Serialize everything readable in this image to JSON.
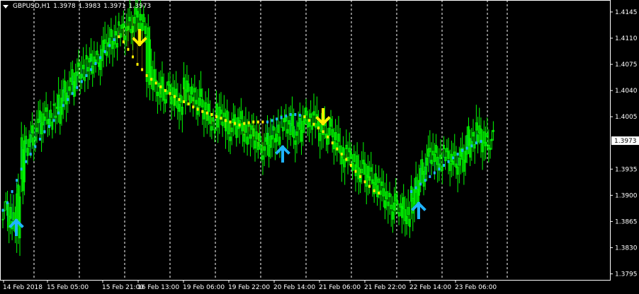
{
  "symbol_header": {
    "symbol": "GBPUSD,H1",
    "open": "1.3978",
    "high": "1.3983",
    "low": "1.3971",
    "close": "1.3973"
  },
  "colors": {
    "background": "#000000",
    "bull_candle": "#00ff00",
    "bear_candle": "#00ff00",
    "grid": "#ffffff",
    "up_signal": "#1fb3ff",
    "down_signal": "#ffee00",
    "price_label_bg": "#ffffff",
    "price_label_fg": "#000000"
  },
  "price_labels": [
    "1.4145",
    "1.4110",
    "1.4075",
    "1.4040",
    "1.4005",
    "1.3973",
    "1.3935",
    "1.3900",
    "1.3865",
    "1.3830",
    "1.3795"
  ],
  "current_price": "1.3973",
  "time_labels": [
    "14 Feb 2018",
    "15 Feb 05:00",
    "15 Feb 21:00",
    "16 Feb 13:00",
    "19 Feb 06:00",
    "19 Feb 22:00",
    "20 Feb 14:00",
    "21 Feb 06:00",
    "21 Feb 22:00",
    "22 Feb 14:00",
    "23 Feb 06:00"
  ],
  "chart_data": {
    "type": "candlestick",
    "title": "GBPUSD,H1",
    "ylim": [
      1.3787,
      1.4161
    ],
    "series": [
      {
        "name": "price",
        "values": [
          1.388,
          1.3865,
          1.3855,
          1.391,
          1.3965,
          1.3975,
          1.3985,
          1.399,
          1.4005,
          1.4,
          1.401,
          1.4008,
          1.403,
          1.4045,
          1.404,
          1.406,
          1.4065,
          1.407,
          1.4075,
          1.4085,
          1.408,
          1.4095,
          1.41,
          1.411,
          1.4115,
          1.412,
          1.4125,
          1.413,
          1.4138,
          1.413,
          1.412,
          1.406,
          1.4045,
          1.405,
          1.4035,
          1.404,
          1.403,
          1.402,
          1.403,
          1.4045,
          1.4035,
          1.403,
          1.402,
          1.401,
          1.4,
          1.3995,
          1.401,
          1.4005,
          1.399,
          1.3985,
          1.4,
          1.399,
          1.398,
          1.3985,
          1.3975,
          1.3965,
          1.396,
          1.3975,
          1.398,
          1.399,
          1.3995,
          1.4,
          1.3985,
          1.398,
          1.3995,
          1.4005,
          1.4,
          1.3995,
          1.3985,
          1.399,
          1.398,
          1.397,
          1.396,
          1.395,
          1.3955,
          1.3945,
          1.393,
          1.3935,
          1.392,
          1.3925,
          1.391,
          1.3905,
          1.3895,
          1.389,
          1.388,
          1.3885,
          1.387,
          1.388,
          1.39,
          1.392,
          1.394,
          1.395,
          1.3955,
          1.3945,
          1.395,
          1.3955,
          1.3945,
          1.395,
          1.394,
          1.3955,
          1.398,
          1.3975,
          1.3985,
          1.397,
          1.3975,
          1.3973
        ]
      },
      {
        "name": "blue_line",
        "values": [
          1.388,
          1.389,
          1.3905,
          1.392,
          1.3935,
          1.3945,
          1.3955,
          1.3965,
          1.3975,
          1.3985,
          1.3992,
          1.4,
          1.401,
          1.402,
          1.4028,
          1.4036,
          1.4044,
          1.4052,
          1.406,
          1.4068,
          1.4076,
          1.4084,
          1.4092,
          1.41,
          1.4108,
          1.4112,
          null,
          null,
          null,
          null,
          null,
          null,
          null,
          null,
          null,
          null,
          null,
          null,
          null,
          null,
          null,
          null,
          null,
          null,
          null,
          null,
          null,
          null,
          null,
          null,
          null,
          null,
          null,
          null,
          null,
          null,
          null,
          1.3998,
          1.4,
          1.4002,
          1.4004,
          1.4006,
          1.4008,
          1.4008,
          1.4007,
          null,
          null,
          null,
          null,
          null,
          null,
          null,
          null,
          null,
          null,
          null,
          null,
          null,
          null,
          null,
          null,
          null,
          null,
          null,
          null,
          null,
          null,
          null,
          1.3905,
          1.391,
          1.3915,
          1.392,
          1.3925,
          1.393,
          1.3935,
          1.394,
          1.3945,
          1.395,
          1.3955,
          1.396,
          1.3963,
          1.3966,
          1.397,
          1.3972
        ]
      },
      {
        "name": "yellow_line",
        "values": [
          null,
          null,
          null,
          null,
          null,
          null,
          null,
          null,
          null,
          null,
          null,
          null,
          null,
          null,
          null,
          null,
          null,
          null,
          null,
          null,
          null,
          null,
          null,
          null,
          null,
          1.4112,
          1.4105,
          1.4095,
          1.4085,
          1.4075,
          1.4068,
          1.406,
          1.4055,
          1.405,
          1.4045,
          1.404,
          1.4036,
          1.4032,
          1.4028,
          1.4025,
          1.4022,
          1.4018,
          1.4015,
          1.4012,
          1.401,
          1.4008,
          1.4005,
          1.4003,
          1.4,
          1.3998,
          1.3996,
          1.3994,
          1.3996,
          1.3997,
          1.3998,
          1.3998,
          1.3998,
          null,
          null,
          null,
          null,
          null,
          null,
          null,
          null,
          1.4005,
          1.4,
          1.3995,
          1.399,
          1.3985,
          1.3978,
          1.397,
          1.3962,
          1.3955,
          1.3948,
          1.394,
          1.3932,
          1.3925,
          1.3918,
          1.3912,
          1.3906,
          1.3903,
          null,
          null,
          null,
          null,
          null,
          null,
          null,
          null,
          null,
          null,
          null,
          null,
          null,
          null,
          null,
          null,
          null,
          null,
          null,
          null,
          null
        ]
      }
    ],
    "signals": [
      {
        "type": "buy",
        "label": "up-arrow"
      },
      {
        "type": "sell",
        "label": "down-arrow"
      },
      {
        "type": "buy",
        "label": "up-arrow"
      },
      {
        "type": "sell",
        "label": "down-arrow"
      },
      {
        "type": "buy",
        "label": "up-arrow"
      }
    ],
    "grid": true,
    "legend": "none"
  }
}
